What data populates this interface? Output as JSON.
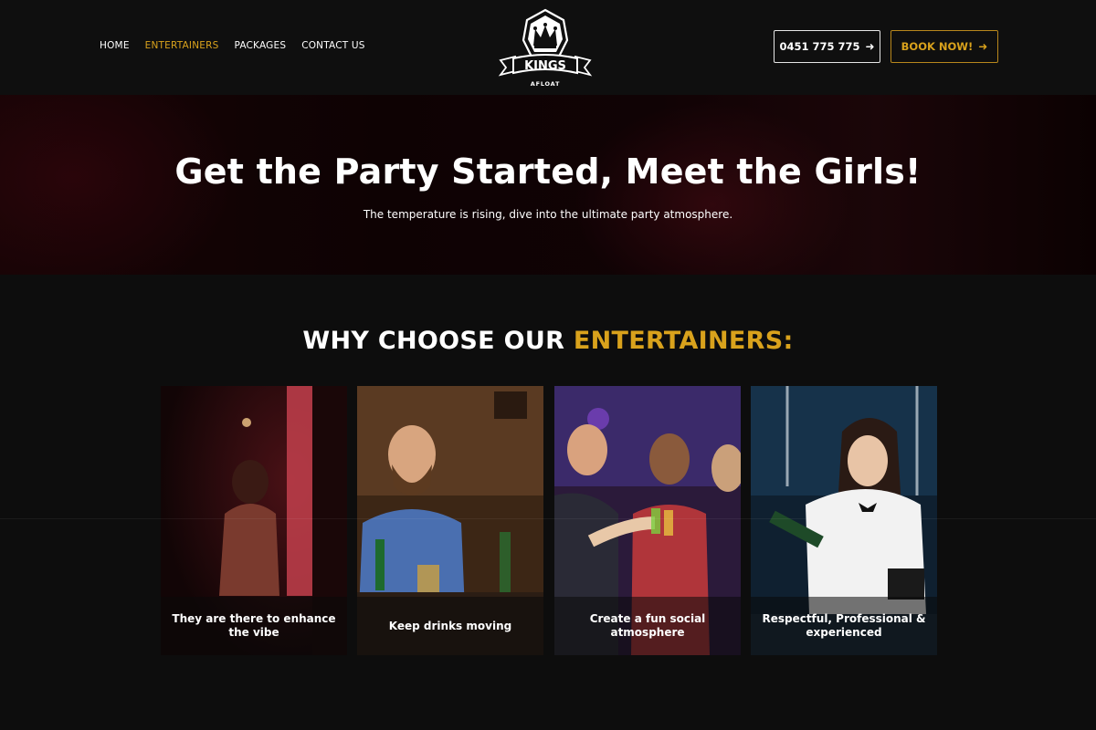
{
  "nav": {
    "items": [
      {
        "label": "HOME"
      },
      {
        "label": "ENTERTAINERS"
      },
      {
        "label": "PACKAGES"
      },
      {
        "label": "CONTACT US"
      }
    ],
    "active_index": 1
  },
  "logo": {
    "text_main": "KINGS",
    "text_sub": "AFLOAT"
  },
  "header_buttons": {
    "phone_label": "0451 775 775",
    "book_label": "BOOK NOW!"
  },
  "hero": {
    "title": "Get the Party Started, Meet the Girls!",
    "subtitle": "The temperature is rising, dive into the ultimate party atmosphere."
  },
  "why": {
    "title_white": "WHY CHOOSE OUR ",
    "title_gold": "ENTERTAINERS:",
    "cards": [
      {
        "caption": "They are there to enhance the vibe"
      },
      {
        "caption": "Keep drinks moving"
      },
      {
        "caption": "Create a fun social atmosphere"
      },
      {
        "caption": "Respectful, Professional & experienced"
      }
    ]
  },
  "colors": {
    "accent": "#d9a21c",
    "background": "#0d0d0d",
    "text": "#ffffff"
  }
}
